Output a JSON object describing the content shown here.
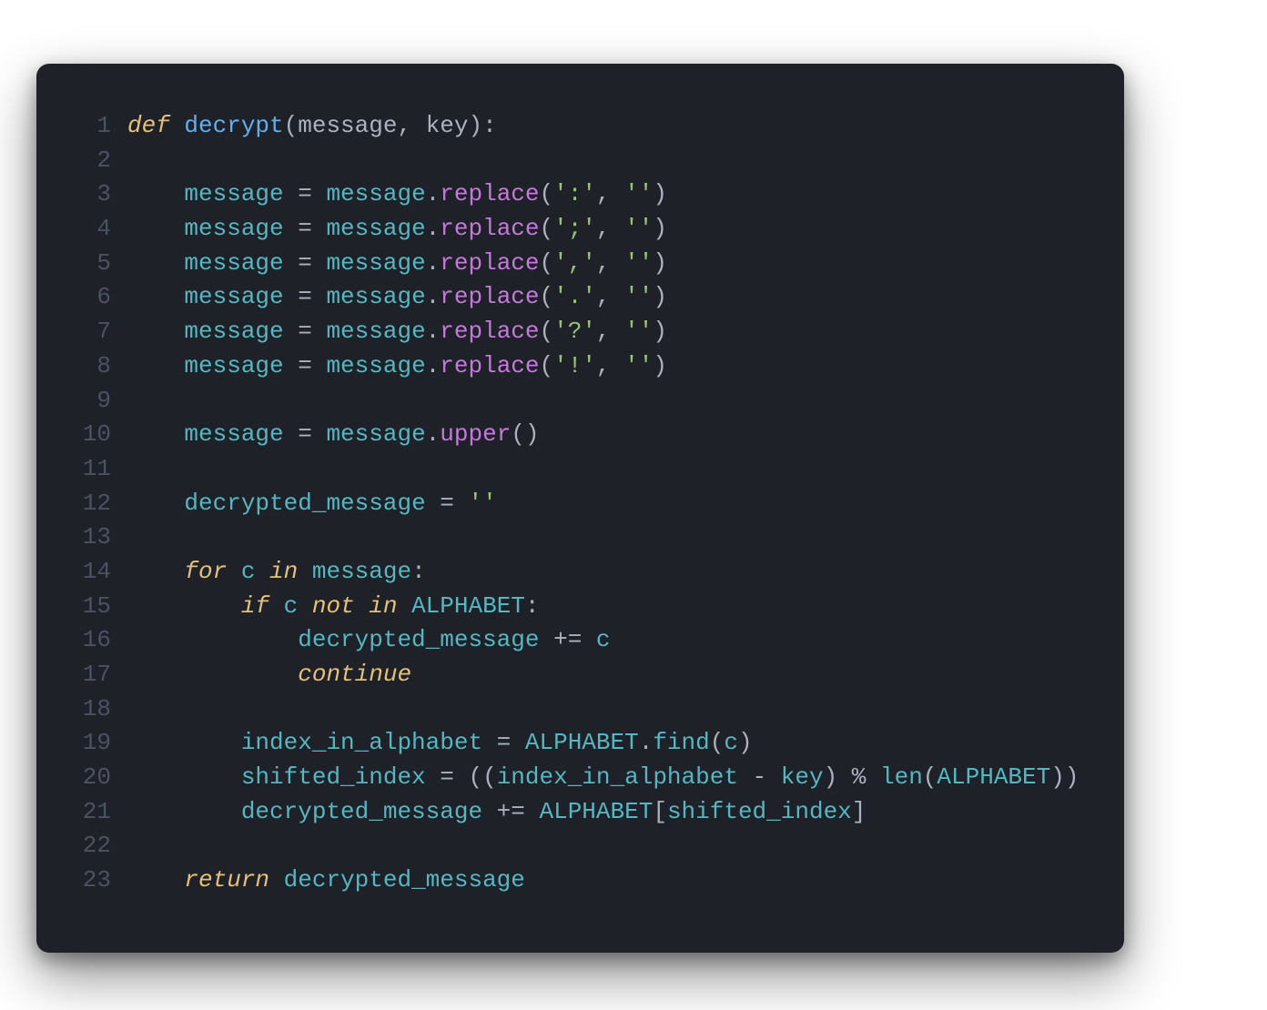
{
  "code": {
    "lines": [
      {
        "num": "1",
        "tokens": [
          {
            "t": "def ",
            "c": "tok-keyword"
          },
          {
            "t": "decrypt",
            "c": "tok-func"
          },
          {
            "t": "(",
            "c": "tok-punct"
          },
          {
            "t": "message",
            "c": "tok-param"
          },
          {
            "t": ", ",
            "c": "tok-punct"
          },
          {
            "t": "key",
            "c": "tok-param"
          },
          {
            "t": "):",
            "c": "tok-punct"
          }
        ]
      },
      {
        "num": "2",
        "tokens": [
          {
            "t": "",
            "c": "tok-default"
          }
        ]
      },
      {
        "num": "3",
        "tokens": [
          {
            "t": "    ",
            "c": "tok-default"
          },
          {
            "t": "message",
            "c": "tok-ident"
          },
          {
            "t": " = ",
            "c": "tok-op"
          },
          {
            "t": "message",
            "c": "tok-ident"
          },
          {
            "t": ".",
            "c": "tok-punct"
          },
          {
            "t": "replace",
            "c": "tok-method"
          },
          {
            "t": "(",
            "c": "tok-punct"
          },
          {
            "t": "':'",
            "c": "tok-string"
          },
          {
            "t": ", ",
            "c": "tok-punct"
          },
          {
            "t": "''",
            "c": "tok-string"
          },
          {
            "t": ")",
            "c": "tok-punct"
          }
        ]
      },
      {
        "num": "4",
        "tokens": [
          {
            "t": "    ",
            "c": "tok-default"
          },
          {
            "t": "message",
            "c": "tok-ident"
          },
          {
            "t": " = ",
            "c": "tok-op"
          },
          {
            "t": "message",
            "c": "tok-ident"
          },
          {
            "t": ".",
            "c": "tok-punct"
          },
          {
            "t": "replace",
            "c": "tok-method"
          },
          {
            "t": "(",
            "c": "tok-punct"
          },
          {
            "t": "';'",
            "c": "tok-string"
          },
          {
            "t": ", ",
            "c": "tok-punct"
          },
          {
            "t": "''",
            "c": "tok-string"
          },
          {
            "t": ")",
            "c": "tok-punct"
          }
        ]
      },
      {
        "num": "5",
        "tokens": [
          {
            "t": "    ",
            "c": "tok-default"
          },
          {
            "t": "message",
            "c": "tok-ident"
          },
          {
            "t": " = ",
            "c": "tok-op"
          },
          {
            "t": "message",
            "c": "tok-ident"
          },
          {
            "t": ".",
            "c": "tok-punct"
          },
          {
            "t": "replace",
            "c": "tok-method"
          },
          {
            "t": "(",
            "c": "tok-punct"
          },
          {
            "t": "','",
            "c": "tok-string"
          },
          {
            "t": ", ",
            "c": "tok-punct"
          },
          {
            "t": "''",
            "c": "tok-string"
          },
          {
            "t": ")",
            "c": "tok-punct"
          }
        ]
      },
      {
        "num": "6",
        "tokens": [
          {
            "t": "    ",
            "c": "tok-default"
          },
          {
            "t": "message",
            "c": "tok-ident"
          },
          {
            "t": " = ",
            "c": "tok-op"
          },
          {
            "t": "message",
            "c": "tok-ident"
          },
          {
            "t": ".",
            "c": "tok-punct"
          },
          {
            "t": "replace",
            "c": "tok-method"
          },
          {
            "t": "(",
            "c": "tok-punct"
          },
          {
            "t": "'.'",
            "c": "tok-string"
          },
          {
            "t": ", ",
            "c": "tok-punct"
          },
          {
            "t": "''",
            "c": "tok-string"
          },
          {
            "t": ")",
            "c": "tok-punct"
          }
        ]
      },
      {
        "num": "7",
        "tokens": [
          {
            "t": "    ",
            "c": "tok-default"
          },
          {
            "t": "message",
            "c": "tok-ident"
          },
          {
            "t": " = ",
            "c": "tok-op"
          },
          {
            "t": "message",
            "c": "tok-ident"
          },
          {
            "t": ".",
            "c": "tok-punct"
          },
          {
            "t": "replace",
            "c": "tok-method"
          },
          {
            "t": "(",
            "c": "tok-punct"
          },
          {
            "t": "'?'",
            "c": "tok-string"
          },
          {
            "t": ", ",
            "c": "tok-punct"
          },
          {
            "t": "''",
            "c": "tok-string"
          },
          {
            "t": ")",
            "c": "tok-punct"
          }
        ]
      },
      {
        "num": "8",
        "tokens": [
          {
            "t": "    ",
            "c": "tok-default"
          },
          {
            "t": "message",
            "c": "tok-ident"
          },
          {
            "t": " = ",
            "c": "tok-op"
          },
          {
            "t": "message",
            "c": "tok-ident"
          },
          {
            "t": ".",
            "c": "tok-punct"
          },
          {
            "t": "replace",
            "c": "tok-method"
          },
          {
            "t": "(",
            "c": "tok-punct"
          },
          {
            "t": "'!'",
            "c": "tok-string"
          },
          {
            "t": ", ",
            "c": "tok-punct"
          },
          {
            "t": "''",
            "c": "tok-string"
          },
          {
            "t": ")",
            "c": "tok-punct"
          }
        ]
      },
      {
        "num": "9",
        "tokens": [
          {
            "t": "",
            "c": "tok-default"
          }
        ]
      },
      {
        "num": "10",
        "tokens": [
          {
            "t": "    ",
            "c": "tok-default"
          },
          {
            "t": "message",
            "c": "tok-ident"
          },
          {
            "t": " = ",
            "c": "tok-op"
          },
          {
            "t": "message",
            "c": "tok-ident"
          },
          {
            "t": ".",
            "c": "tok-punct"
          },
          {
            "t": "upper",
            "c": "tok-method"
          },
          {
            "t": "()",
            "c": "tok-punct"
          }
        ]
      },
      {
        "num": "11",
        "tokens": [
          {
            "t": "",
            "c": "tok-default"
          }
        ]
      },
      {
        "num": "12",
        "tokens": [
          {
            "t": "    ",
            "c": "tok-default"
          },
          {
            "t": "decrypted_message",
            "c": "tok-ident"
          },
          {
            "t": " = ",
            "c": "tok-op"
          },
          {
            "t": "''",
            "c": "tok-string"
          }
        ]
      },
      {
        "num": "13",
        "tokens": [
          {
            "t": "",
            "c": "tok-default"
          }
        ]
      },
      {
        "num": "14",
        "tokens": [
          {
            "t": "    ",
            "c": "tok-default"
          },
          {
            "t": "for ",
            "c": "tok-keyword"
          },
          {
            "t": "c",
            "c": "tok-ident"
          },
          {
            "t": " in ",
            "c": "tok-keyword"
          },
          {
            "t": "message",
            "c": "tok-ident"
          },
          {
            "t": ":",
            "c": "tok-punct"
          }
        ]
      },
      {
        "num": "15",
        "tokens": [
          {
            "t": "        ",
            "c": "tok-default"
          },
          {
            "t": "if ",
            "c": "tok-keyword"
          },
          {
            "t": "c",
            "c": "tok-ident"
          },
          {
            "t": " not in ",
            "c": "tok-keyword"
          },
          {
            "t": "ALPHABET",
            "c": "tok-ident"
          },
          {
            "t": ":",
            "c": "tok-punct"
          }
        ]
      },
      {
        "num": "16",
        "tokens": [
          {
            "t": "            ",
            "c": "tok-default"
          },
          {
            "t": "decrypted_message",
            "c": "tok-ident"
          },
          {
            "t": " += ",
            "c": "tok-op"
          },
          {
            "t": "c",
            "c": "tok-ident"
          }
        ]
      },
      {
        "num": "17",
        "tokens": [
          {
            "t": "            ",
            "c": "tok-default"
          },
          {
            "t": "continue",
            "c": "tok-keyword"
          }
        ]
      },
      {
        "num": "18",
        "tokens": [
          {
            "t": "",
            "c": "tok-default"
          }
        ]
      },
      {
        "num": "19",
        "tokens": [
          {
            "t": "        ",
            "c": "tok-default"
          },
          {
            "t": "index_in_alphabet",
            "c": "tok-ident"
          },
          {
            "t": " = ",
            "c": "tok-op"
          },
          {
            "t": "ALPHABET",
            "c": "tok-ident"
          },
          {
            "t": ".",
            "c": "tok-punct"
          },
          {
            "t": "find",
            "c": "tok-method2"
          },
          {
            "t": "(",
            "c": "tok-punct"
          },
          {
            "t": "c",
            "c": "tok-ident"
          },
          {
            "t": ")",
            "c": "tok-punct"
          }
        ]
      },
      {
        "num": "20",
        "tokens": [
          {
            "t": "        ",
            "c": "tok-default"
          },
          {
            "t": "shifted_index",
            "c": "tok-ident"
          },
          {
            "t": " = ((",
            "c": "tok-punct"
          },
          {
            "t": "index_in_alphabet",
            "c": "tok-ident"
          },
          {
            "t": " - ",
            "c": "tok-op"
          },
          {
            "t": "key",
            "c": "tok-ident"
          },
          {
            "t": ") % ",
            "c": "tok-op"
          },
          {
            "t": "len",
            "c": "tok-builtin"
          },
          {
            "t": "(",
            "c": "tok-punct"
          },
          {
            "t": "ALPHABET",
            "c": "tok-ident"
          },
          {
            "t": "))",
            "c": "tok-punct"
          }
        ]
      },
      {
        "num": "21",
        "tokens": [
          {
            "t": "        ",
            "c": "tok-default"
          },
          {
            "t": "decrypted_message",
            "c": "tok-ident"
          },
          {
            "t": " += ",
            "c": "tok-op"
          },
          {
            "t": "ALPHABET",
            "c": "tok-ident"
          },
          {
            "t": "[",
            "c": "tok-punct"
          },
          {
            "t": "shifted_index",
            "c": "tok-ident"
          },
          {
            "t": "]",
            "c": "tok-punct"
          }
        ]
      },
      {
        "num": "22",
        "tokens": [
          {
            "t": "",
            "c": "tok-default"
          }
        ]
      },
      {
        "num": "23",
        "tokens": [
          {
            "t": "    ",
            "c": "tok-default"
          },
          {
            "t": "return ",
            "c": "tok-keyword"
          },
          {
            "t": "decrypted_message",
            "c": "tok-ident"
          }
        ]
      }
    ]
  }
}
